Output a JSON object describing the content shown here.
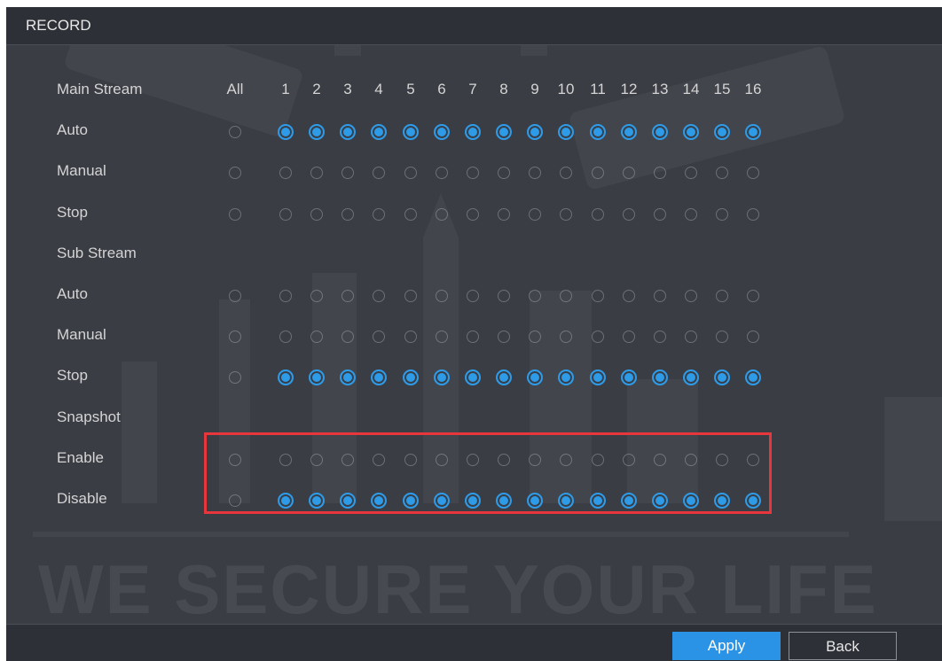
{
  "window": {
    "title": "RECORD"
  },
  "columns": [
    "All",
    "1",
    "2",
    "3",
    "4",
    "5",
    "6",
    "7",
    "8",
    "9",
    "10",
    "11",
    "12",
    "13",
    "14",
    "15",
    "16"
  ],
  "sections": [
    {
      "key": "main_stream",
      "label": "Main Stream",
      "options": [
        {
          "key": "auto",
          "label": "Auto",
          "all_checked": false,
          "checked": [
            true,
            true,
            true,
            true,
            true,
            true,
            true,
            true,
            true,
            true,
            true,
            true,
            true,
            true,
            true,
            true
          ]
        },
        {
          "key": "manual",
          "label": "Manual",
          "all_checked": false,
          "checked": [
            false,
            false,
            false,
            false,
            false,
            false,
            false,
            false,
            false,
            false,
            false,
            false,
            false,
            false,
            false,
            false
          ]
        },
        {
          "key": "stop",
          "label": "Stop",
          "all_checked": false,
          "checked": [
            false,
            false,
            false,
            false,
            false,
            false,
            false,
            false,
            false,
            false,
            false,
            false,
            false,
            false,
            false,
            false
          ]
        }
      ]
    },
    {
      "key": "sub_stream",
      "label": "Sub Stream",
      "options": [
        {
          "key": "auto",
          "label": "Auto",
          "all_checked": false,
          "checked": [
            false,
            false,
            false,
            false,
            false,
            false,
            false,
            false,
            false,
            false,
            false,
            false,
            false,
            false,
            false,
            false
          ]
        },
        {
          "key": "manual",
          "label": "Manual",
          "all_checked": false,
          "checked": [
            false,
            false,
            false,
            false,
            false,
            false,
            false,
            false,
            false,
            false,
            false,
            false,
            false,
            false,
            false,
            false
          ]
        },
        {
          "key": "stop",
          "label": "Stop",
          "all_checked": false,
          "checked": [
            true,
            true,
            true,
            true,
            true,
            true,
            true,
            true,
            true,
            true,
            true,
            true,
            true,
            true,
            true,
            true
          ]
        }
      ]
    },
    {
      "key": "snapshot",
      "label": "Snapshot",
      "options": [
        {
          "key": "enable",
          "label": "Enable",
          "all_checked": false,
          "checked": [
            false,
            false,
            false,
            false,
            false,
            false,
            false,
            false,
            false,
            false,
            false,
            false,
            false,
            false,
            false,
            false
          ]
        },
        {
          "key": "disable",
          "label": "Disable",
          "all_checked": false,
          "checked": [
            true,
            true,
            true,
            true,
            true,
            true,
            true,
            true,
            true,
            true,
            true,
            true,
            true,
            true,
            true,
            true
          ]
        }
      ]
    }
  ],
  "background": {
    "slogan": "WE SECURE YOUR LIFE"
  },
  "footer": {
    "apply_label": "Apply",
    "back_label": "Back"
  },
  "colors": {
    "accent": "#2a93e6",
    "highlight_box": "#e8363d",
    "panel_bg": "#3a3d44"
  }
}
